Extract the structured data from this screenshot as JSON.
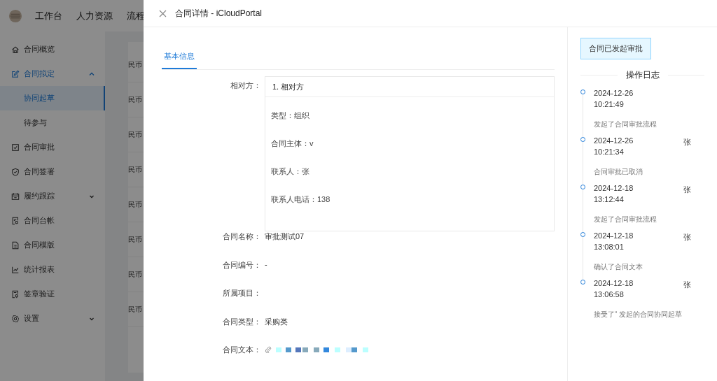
{
  "top_nav": {
    "items": [
      "工作台",
      "人力资源",
      "流程"
    ]
  },
  "sidebar": {
    "items": [
      {
        "label": "合同概览",
        "selected": false
      },
      {
        "label": "合同拟定",
        "selected": true,
        "expanded": true,
        "children": [
          {
            "label": "协同起草",
            "selected": true
          },
          {
            "label": "待参与",
            "selected": false
          }
        ]
      },
      {
        "label": "合同审批",
        "selected": false
      },
      {
        "label": "合同签署",
        "selected": false
      },
      {
        "label": "履约跟踪",
        "selected": false,
        "expanded": false
      },
      {
        "label": "合同台帐",
        "selected": false
      },
      {
        "label": "合同模版",
        "selected": false
      },
      {
        "label": "统计报表",
        "selected": false
      },
      {
        "label": "签章验证",
        "selected": false
      },
      {
        "label": "设置",
        "selected": false,
        "expanded": false
      }
    ]
  },
  "table": {
    "column_1": [
      "民币",
      "民币",
      "民币",
      "民币",
      "民币",
      "民币",
      "民币",
      "民币"
    ]
  },
  "drawer": {
    "title": "合同详情 - iCloudPortal",
    "tabs": [
      {
        "label": "基本信息",
        "selected": true
      }
    ],
    "counterparty": {
      "label": "相对方：",
      "header": "1. 相对方",
      "lines": [
        "类型：组织",
        "合同主体：v",
        "联系人：张",
        "联系人电话：138"
      ]
    },
    "fields": [
      {
        "label": "合同名称：",
        "value": "审批测试07",
        "kind": "text"
      },
      {
        "label": "合同编号：",
        "value": "-",
        "kind": "text"
      },
      {
        "label": "所属项目：",
        "kind": "text"
      },
      {
        "label": "合同类型：",
        "value": "采购类",
        "kind": "text"
      },
      {
        "label": "合同文本：",
        "kind": "attachment"
      }
    ],
    "status": "合同已发起审批",
    "log": {
      "title": "操作日志",
      "entries": [
        {
          "date": "2024-12-26",
          "time": "10:21:49",
          "action": "发起了合同审批流程"
        },
        {
          "date": "2024-12-26",
          "time": "10:21:34",
          "user": "张",
          "action": "合同审批已取消"
        },
        {
          "date": "2024-12-18",
          "time": "13:12:44",
          "user": "张",
          "action": "发起了合同审批流程"
        },
        {
          "date": "2024-12-18",
          "time": "13:08:01",
          "user": "张",
          "action": "确认了合同文本"
        },
        {
          "date": "2024-12-18",
          "time": "13:06:58",
          "user": "张",
          "action": "接受了“ 发起的合同协同起草"
        }
      ]
    }
  }
}
